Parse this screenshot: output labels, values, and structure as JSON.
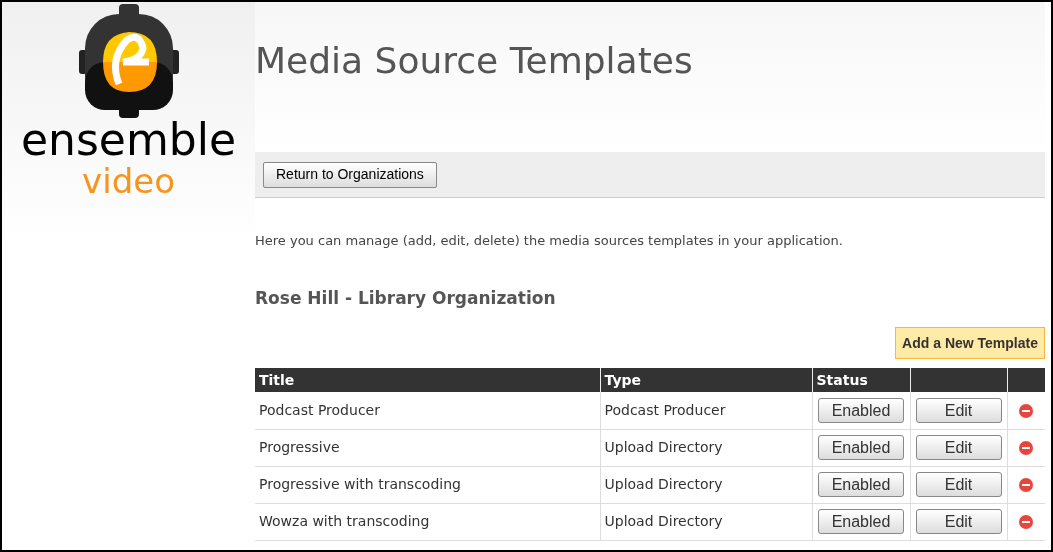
{
  "logo": {
    "name": "ensemble",
    "tagline": "video"
  },
  "page_title": "Media Source Templates",
  "toolbar": {
    "return_button": "Return to Organizations"
  },
  "description": "Here you can manage (add, edit, delete) the media sources templates in your application.",
  "organization": "Rose Hill - Library Organization",
  "add_button": "Add a New Template",
  "table": {
    "columns": [
      "Title",
      "Type",
      "Status"
    ],
    "rows": [
      {
        "title": "Podcast Producer",
        "type": "Podcast Producer",
        "status": "Enabled",
        "edit": "Edit"
      },
      {
        "title": "Progressive",
        "type": "Upload Directory",
        "status": "Enabled",
        "edit": "Edit"
      },
      {
        "title": "Progressive with transcoding",
        "type": "Upload Directory",
        "status": "Enabled",
        "edit": "Edit"
      },
      {
        "title": "Wowza with transcoding",
        "type": "Upload Directory",
        "status": "Enabled",
        "edit": "Edit"
      }
    ]
  }
}
